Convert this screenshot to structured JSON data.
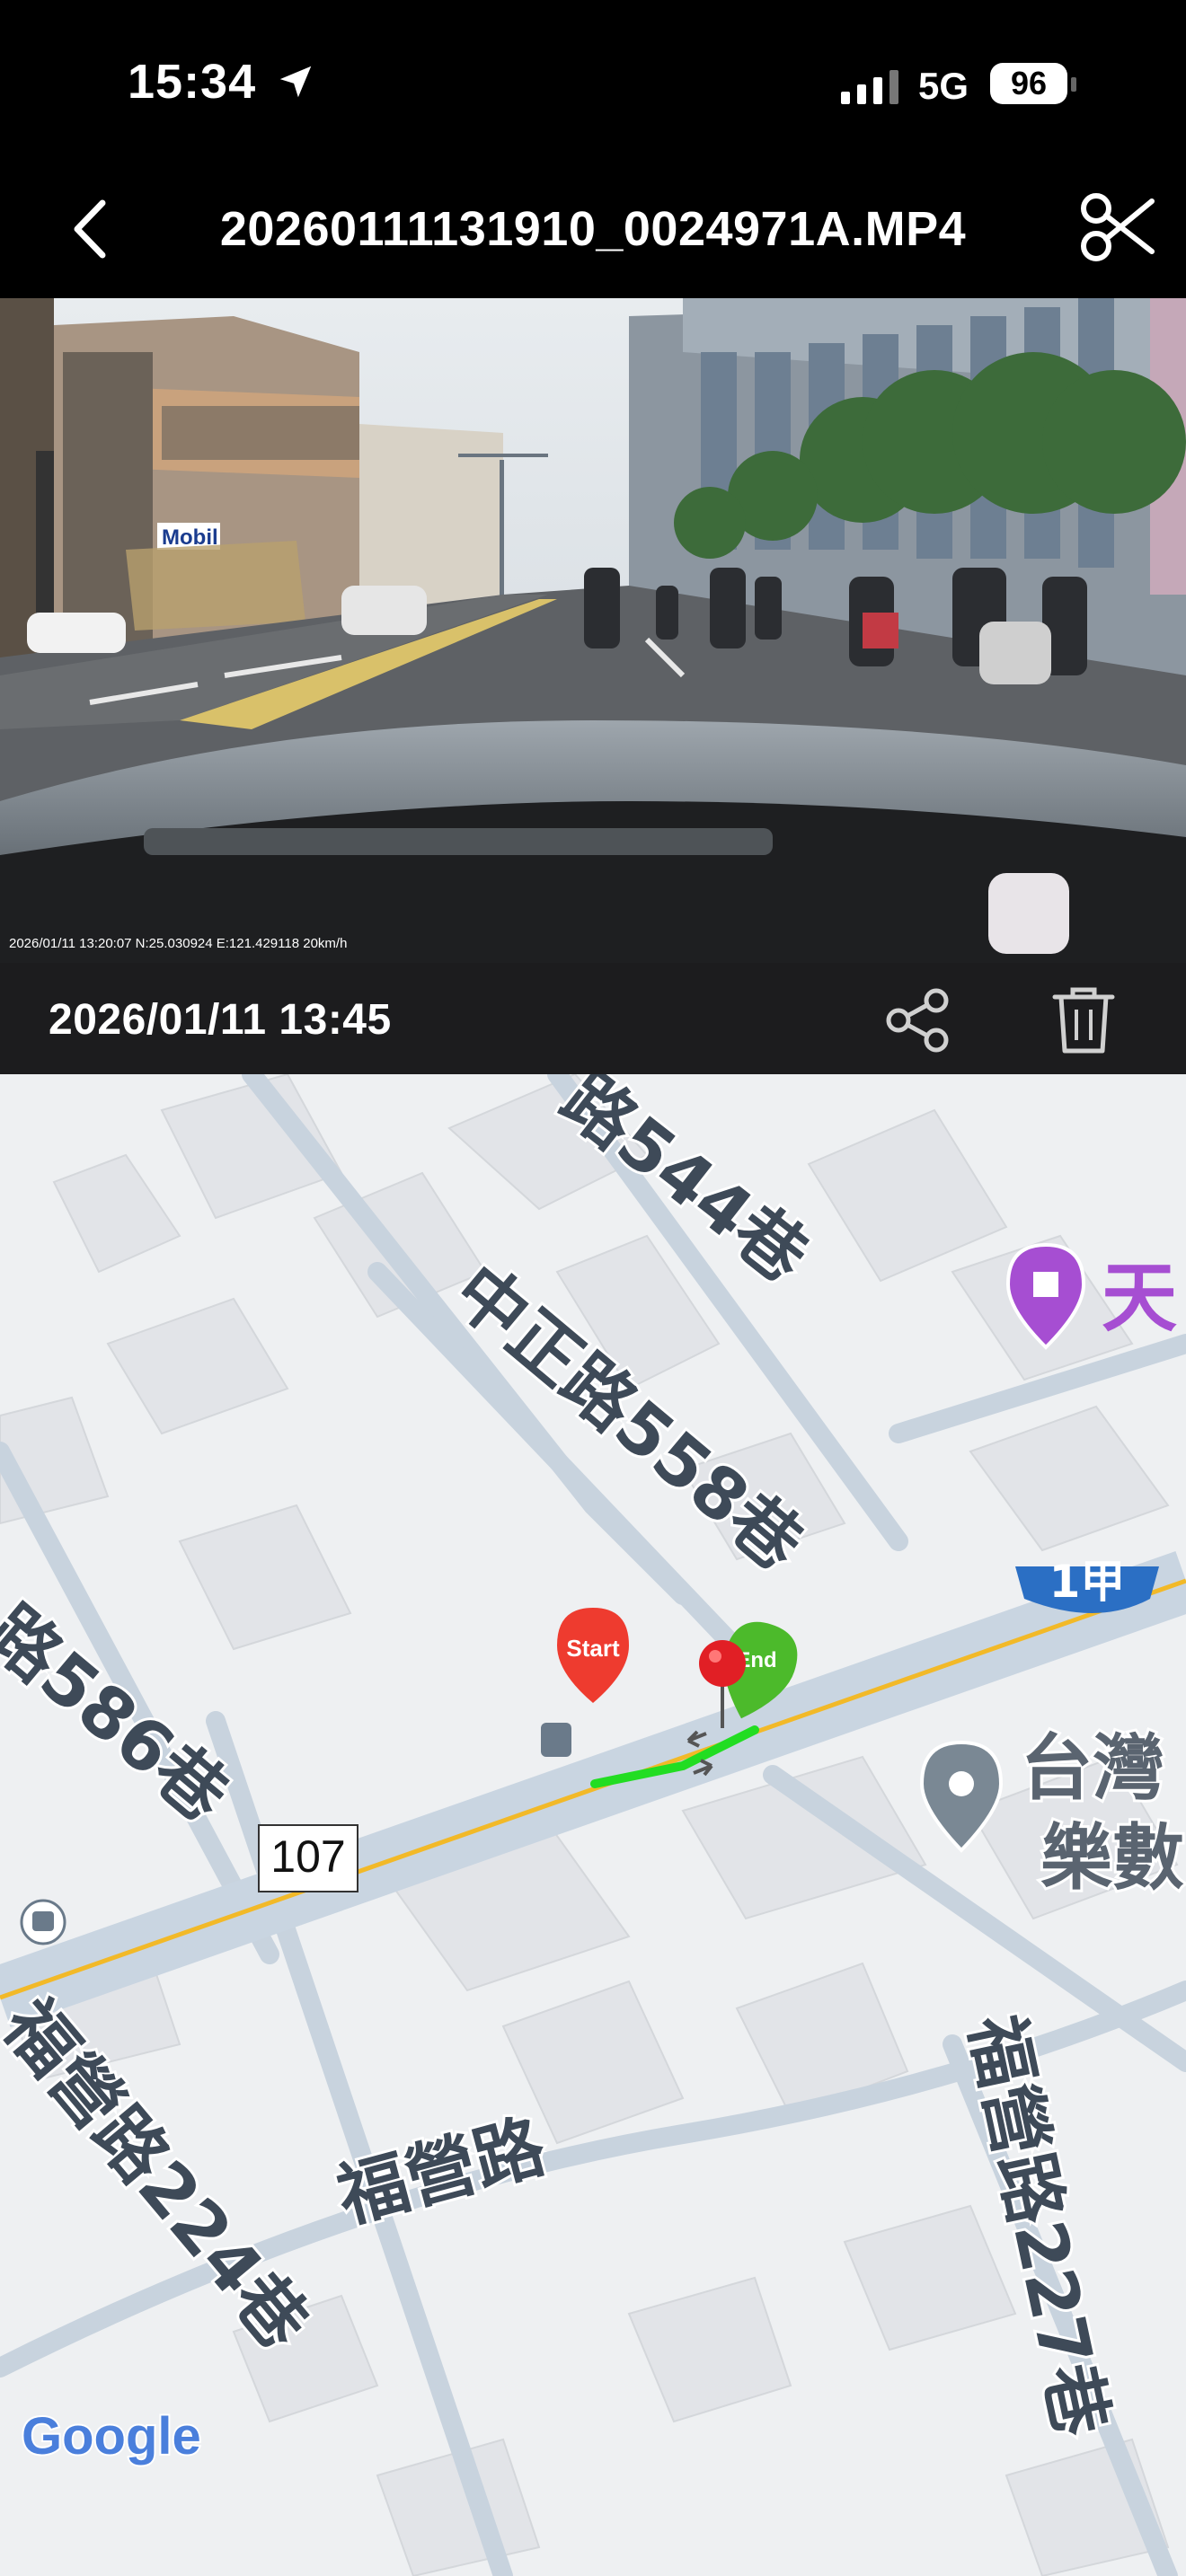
{
  "status_bar": {
    "time": "15:34",
    "network": "5G",
    "battery": "96"
  },
  "nav": {
    "title": "20260111131910_0024971A.MP4"
  },
  "video": {
    "overlay_text": "2026/01/11 13:20:07  N:25.030924 E:121.429118  20km/h",
    "sign_text": "Mobil"
  },
  "info": {
    "datetime": "2026/01/11 13:45"
  },
  "map": {
    "labels": {
      "alley_544": "路544巷",
      "alley_558": "中正路558巷",
      "alley_586": "路586巷",
      "alley_224": "福營路224巷",
      "road_fuying": "福營路",
      "alley_227": "福營路227巷",
      "route_1a": "1甲",
      "route_107": "107",
      "poi_temple": "天",
      "poi_taiwan_1": "台灣",
      "poi_taiwan_2": "樂數",
      "start": "Start",
      "end": "End",
      "google": "Google"
    },
    "colors": {
      "route": "#22dd22",
      "start_pin": "#ee3b2f",
      "end_pin": "#4cba2b",
      "highway": "#2b6fc4",
      "poi_purple": "#a64ed2",
      "road_yellow": "#f2b928"
    }
  }
}
